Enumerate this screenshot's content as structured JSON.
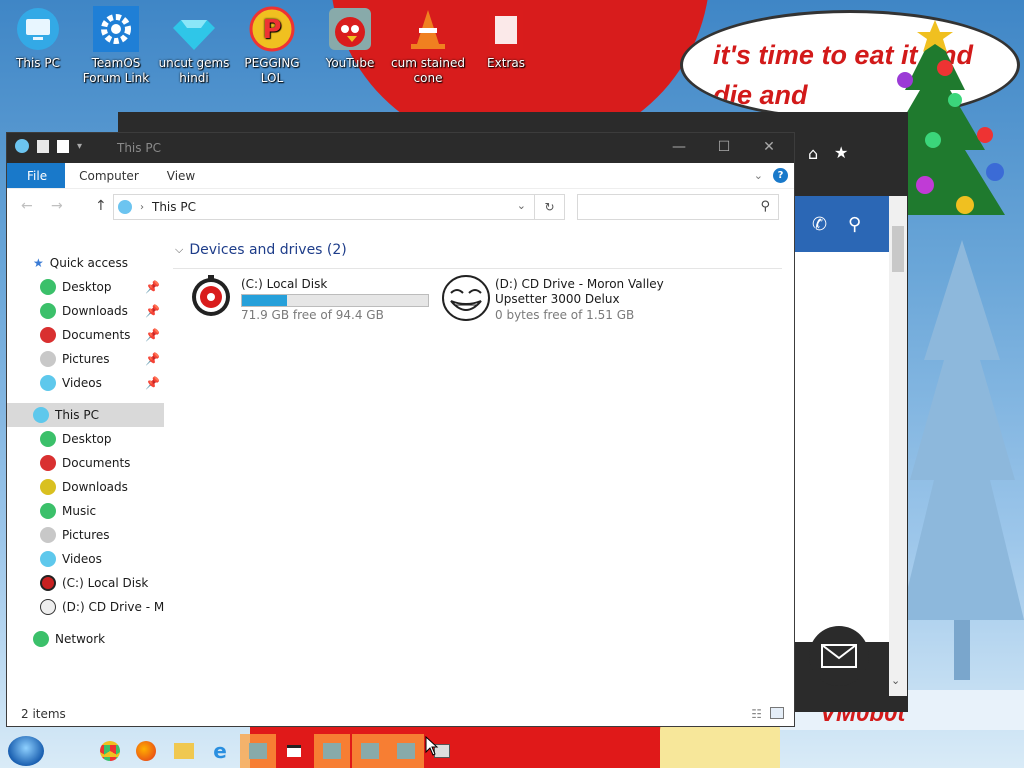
{
  "desktop": {
    "icons": [
      {
        "label": "This PC"
      },
      {
        "label": "TeamOS Forum Link"
      },
      {
        "label": "uncut gems hindi"
      },
      {
        "label": "PEGGING LOL"
      },
      {
        "label": "YouTube"
      },
      {
        "label": "cum stained cone"
      },
      {
        "label": "Extras"
      }
    ],
    "speech_text": "it's time to eat it and die and",
    "sign_text": "VM0b0t"
  },
  "window": {
    "title": "This PC",
    "ribbon_tabs": [
      "File",
      "Computer",
      "View"
    ],
    "address": "This PC",
    "search_placeholder": "",
    "nav": {
      "quick_access": "Quick access",
      "quick_items": [
        "Desktop",
        "Downloads",
        "Documents",
        "Pictures",
        "Videos"
      ],
      "this_pc": "This PC",
      "pc_items": [
        "Desktop",
        "Documents",
        "Downloads",
        "Music",
        "Pictures",
        "Videos",
        "(C:) Local Disk",
        "(D:) CD Drive - Moron Valley"
      ],
      "network": "Network"
    },
    "group_header": "Devices and drives (2)",
    "drives": [
      {
        "name": "(C:) Local Disk",
        "free": "71.9 GB free of 94.4 GB",
        "used_fraction": 0.24
      },
      {
        "name": "(D:) CD Drive - Moron Valley",
        "name2": "Upsetter 3000 Delux",
        "free": "0 bytes free of 1.51 GB"
      }
    ],
    "status": "2 items"
  },
  "colors": {
    "accent": "#1979ca",
    "titlebar": "#2b2b2b",
    "bar_fill": "#26a0da",
    "group_header": "#1e3d8a"
  }
}
